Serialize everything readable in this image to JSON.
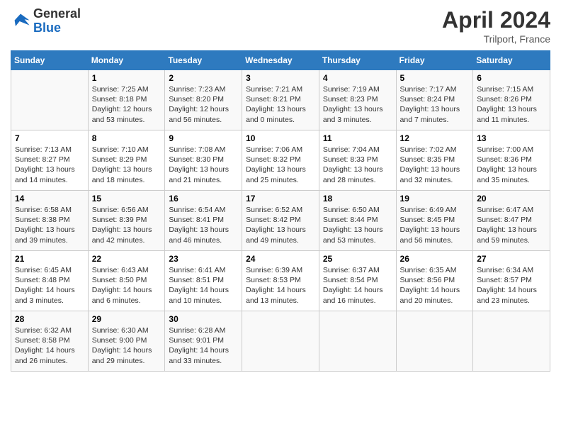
{
  "header": {
    "logo_general": "General",
    "logo_blue": "Blue",
    "month_title": "April 2024",
    "location": "Trilport, France"
  },
  "days_of_week": [
    "Sunday",
    "Monday",
    "Tuesday",
    "Wednesday",
    "Thursday",
    "Friday",
    "Saturday"
  ],
  "weeks": [
    [
      {
        "day": "",
        "info": ""
      },
      {
        "day": "1",
        "info": "Sunrise: 7:25 AM\nSunset: 8:18 PM\nDaylight: 12 hours\nand 53 minutes."
      },
      {
        "day": "2",
        "info": "Sunrise: 7:23 AM\nSunset: 8:20 PM\nDaylight: 12 hours\nand 56 minutes."
      },
      {
        "day": "3",
        "info": "Sunrise: 7:21 AM\nSunset: 8:21 PM\nDaylight: 13 hours\nand 0 minutes."
      },
      {
        "day": "4",
        "info": "Sunrise: 7:19 AM\nSunset: 8:23 PM\nDaylight: 13 hours\nand 3 minutes."
      },
      {
        "day": "5",
        "info": "Sunrise: 7:17 AM\nSunset: 8:24 PM\nDaylight: 13 hours\nand 7 minutes."
      },
      {
        "day": "6",
        "info": "Sunrise: 7:15 AM\nSunset: 8:26 PM\nDaylight: 13 hours\nand 11 minutes."
      }
    ],
    [
      {
        "day": "7",
        "info": "Sunrise: 7:13 AM\nSunset: 8:27 PM\nDaylight: 13 hours\nand 14 minutes."
      },
      {
        "day": "8",
        "info": "Sunrise: 7:10 AM\nSunset: 8:29 PM\nDaylight: 13 hours\nand 18 minutes."
      },
      {
        "day": "9",
        "info": "Sunrise: 7:08 AM\nSunset: 8:30 PM\nDaylight: 13 hours\nand 21 minutes."
      },
      {
        "day": "10",
        "info": "Sunrise: 7:06 AM\nSunset: 8:32 PM\nDaylight: 13 hours\nand 25 minutes."
      },
      {
        "day": "11",
        "info": "Sunrise: 7:04 AM\nSunset: 8:33 PM\nDaylight: 13 hours\nand 28 minutes."
      },
      {
        "day": "12",
        "info": "Sunrise: 7:02 AM\nSunset: 8:35 PM\nDaylight: 13 hours\nand 32 minutes."
      },
      {
        "day": "13",
        "info": "Sunrise: 7:00 AM\nSunset: 8:36 PM\nDaylight: 13 hours\nand 35 minutes."
      }
    ],
    [
      {
        "day": "14",
        "info": "Sunrise: 6:58 AM\nSunset: 8:38 PM\nDaylight: 13 hours\nand 39 minutes."
      },
      {
        "day": "15",
        "info": "Sunrise: 6:56 AM\nSunset: 8:39 PM\nDaylight: 13 hours\nand 42 minutes."
      },
      {
        "day": "16",
        "info": "Sunrise: 6:54 AM\nSunset: 8:41 PM\nDaylight: 13 hours\nand 46 minutes."
      },
      {
        "day": "17",
        "info": "Sunrise: 6:52 AM\nSunset: 8:42 PM\nDaylight: 13 hours\nand 49 minutes."
      },
      {
        "day": "18",
        "info": "Sunrise: 6:50 AM\nSunset: 8:44 PM\nDaylight: 13 hours\nand 53 minutes."
      },
      {
        "day": "19",
        "info": "Sunrise: 6:49 AM\nSunset: 8:45 PM\nDaylight: 13 hours\nand 56 minutes."
      },
      {
        "day": "20",
        "info": "Sunrise: 6:47 AM\nSunset: 8:47 PM\nDaylight: 13 hours\nand 59 minutes."
      }
    ],
    [
      {
        "day": "21",
        "info": "Sunrise: 6:45 AM\nSunset: 8:48 PM\nDaylight: 14 hours\nand 3 minutes."
      },
      {
        "day": "22",
        "info": "Sunrise: 6:43 AM\nSunset: 8:50 PM\nDaylight: 14 hours\nand 6 minutes."
      },
      {
        "day": "23",
        "info": "Sunrise: 6:41 AM\nSunset: 8:51 PM\nDaylight: 14 hours\nand 10 minutes."
      },
      {
        "day": "24",
        "info": "Sunrise: 6:39 AM\nSunset: 8:53 PM\nDaylight: 14 hours\nand 13 minutes."
      },
      {
        "day": "25",
        "info": "Sunrise: 6:37 AM\nSunset: 8:54 PM\nDaylight: 14 hours\nand 16 minutes."
      },
      {
        "day": "26",
        "info": "Sunrise: 6:35 AM\nSunset: 8:56 PM\nDaylight: 14 hours\nand 20 minutes."
      },
      {
        "day": "27",
        "info": "Sunrise: 6:34 AM\nSunset: 8:57 PM\nDaylight: 14 hours\nand 23 minutes."
      }
    ],
    [
      {
        "day": "28",
        "info": "Sunrise: 6:32 AM\nSunset: 8:58 PM\nDaylight: 14 hours\nand 26 minutes."
      },
      {
        "day": "29",
        "info": "Sunrise: 6:30 AM\nSunset: 9:00 PM\nDaylight: 14 hours\nand 29 minutes."
      },
      {
        "day": "30",
        "info": "Sunrise: 6:28 AM\nSunset: 9:01 PM\nDaylight: 14 hours\nand 33 minutes."
      },
      {
        "day": "",
        "info": ""
      },
      {
        "day": "",
        "info": ""
      },
      {
        "day": "",
        "info": ""
      },
      {
        "day": "",
        "info": ""
      }
    ]
  ]
}
